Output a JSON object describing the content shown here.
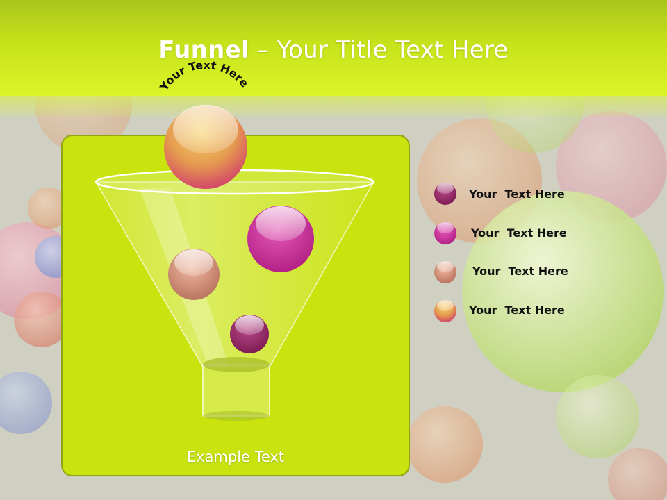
{
  "slide": {
    "title_bold": "Funnel",
    "title_rest": " – Your Title Text Here",
    "arc_text": "Your Text Here",
    "example_text": "Example Text",
    "legend": [
      {
        "label": "Your  Text Here",
        "color": "#8e1d5e"
      },
      {
        "label": "Your  Text Here",
        "color": "#c72690"
      },
      {
        "label": "Your  Text Here",
        "color": "#c98a74"
      },
      {
        "label": "Your  Text Here",
        "color": "#d4a24a"
      }
    ]
  },
  "colors": {
    "header": "#c6e21a",
    "panel": "#c8e30e",
    "panel_border": "#8ea514"
  }
}
